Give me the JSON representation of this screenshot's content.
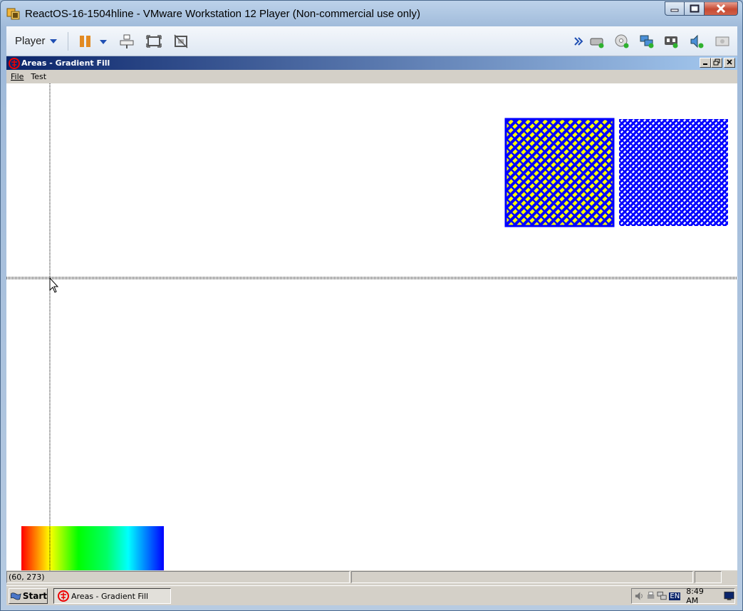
{
  "vm": {
    "title": "ReactOS-16-1504hline - VMware Workstation 12 Player (Non-commercial use only)",
    "player_label": "Player"
  },
  "guest": {
    "window_title": "Areas - Gradient Fill",
    "menu": [
      "File",
      "Test"
    ],
    "status_coords": "(60, 273)",
    "taskbar": {
      "start_label": "Start",
      "task_label": "Areas - Gradient Fill",
      "lang": "EN",
      "clock": "8:49 AM"
    }
  },
  "colors": {
    "pattern_fill": "#0000ff",
    "pattern_bg": "#ffff00",
    "guest_title_start": "#0a246a",
    "guest_title_end": "#a6caf0"
  },
  "icons": {
    "vm_toolbar": [
      "pause-icon",
      "send-ctrl-alt-del-icon",
      "fullscreen-icon",
      "unity-icon"
    ],
    "devices": [
      "hard-disk-icon",
      "cd-dvd-icon",
      "network-icon",
      "usb-icon",
      "sound-icon",
      "display-icon"
    ]
  }
}
